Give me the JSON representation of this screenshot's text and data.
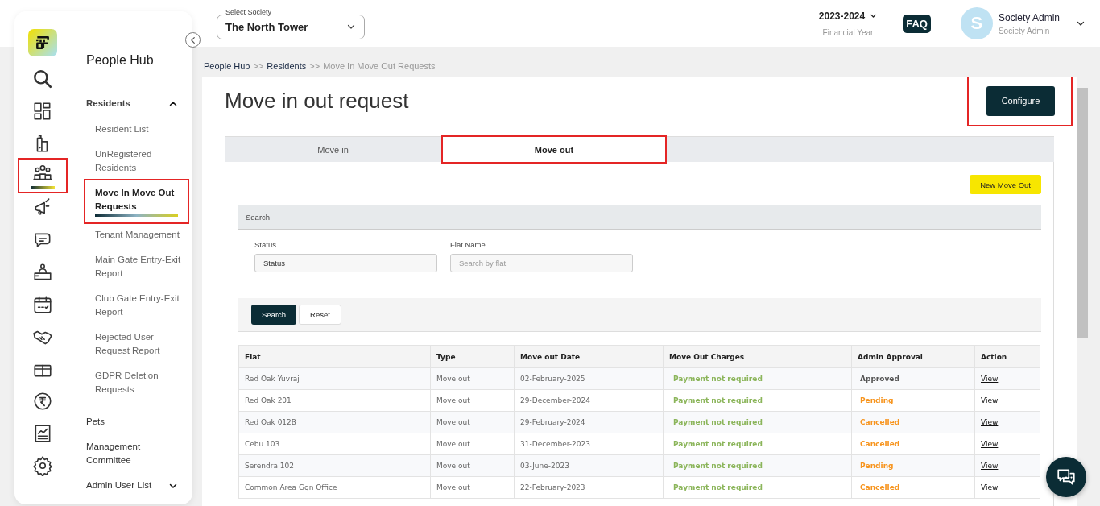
{
  "sidebar": {
    "rail": [
      {
        "selected": false,
        "highlighted": false
      },
      {
        "selected": false,
        "highlighted": false
      },
      {
        "selected": false,
        "highlighted": false
      },
      {
        "selected": true,
        "highlighted": true
      },
      {
        "selected": false,
        "highlighted": false
      },
      {
        "selected": false,
        "highlighted": false
      },
      {
        "selected": false,
        "highlighted": false
      },
      {
        "selected": false,
        "highlighted": false
      },
      {
        "selected": false,
        "highlighted": false
      },
      {
        "selected": false,
        "highlighted": false
      },
      {
        "selected": false,
        "highlighted": false
      },
      {
        "selected": false,
        "highlighted": false
      },
      {
        "selected": false,
        "highlighted": false
      }
    ],
    "title": "People Hub",
    "sections": [
      {
        "label": "Residents",
        "expanded": true,
        "children": [
          {
            "label": "Resident List",
            "selected": false,
            "highlighted": false
          },
          {
            "label": "UnRegistered Residents",
            "selected": false,
            "highlighted": false
          },
          {
            "label": "Move In Move Out Requests",
            "selected": true,
            "highlighted": true
          },
          {
            "label": "Tenant Management",
            "selected": false,
            "highlighted": false
          },
          {
            "label": "Main Gate Entry-Exit Report",
            "selected": false,
            "highlighted": false
          },
          {
            "label": "Club Gate Entry-Exit Report",
            "selected": false,
            "highlighted": false
          },
          {
            "label": "Rejected User Request Report",
            "selected": false,
            "highlighted": false
          },
          {
            "label": "GDPR Deletion Requests",
            "selected": false,
            "highlighted": false
          }
        ]
      },
      {
        "label": "Pets"
      },
      {
        "label": "Management Committee"
      },
      {
        "label": "Admin User List",
        "expanded": false
      }
    ]
  },
  "header": {
    "society_select": {
      "label": "Select Society",
      "value": "The North Tower"
    },
    "financial_year": {
      "value": "2023-2024",
      "label": "Financial Year"
    },
    "faq": "FAQ",
    "user": {
      "avatar": "S",
      "name": "Society Admin",
      "role": "Society Admin"
    }
  },
  "breadcrumb": [
    {
      "kind": "link",
      "text": "People Hub"
    },
    {
      "kind": "separator",
      "text": ">>"
    },
    {
      "kind": "link",
      "text": "Residents"
    },
    {
      "kind": "separator",
      "text": ">>"
    },
    {
      "kind": "current",
      "text": "Move In Move Out Requests"
    }
  ],
  "page": {
    "title": "Move in out request",
    "configure_button": {
      "label": "Configure",
      "highlighted": true
    },
    "tabs": [
      {
        "label": "Move in",
        "selected": false,
        "highlighted": false
      },
      {
        "label": "Move out",
        "selected": true,
        "highlighted": true
      }
    ],
    "new_button": "New Move Out",
    "search": {
      "title": "Search",
      "fields": [
        {
          "label": "Status",
          "value": "Status"
        },
        {
          "label": "Flat Name",
          "placeholder": "Search by flat"
        }
      ],
      "buttons": [
        {
          "label": "Search",
          "kind": "primary"
        },
        {
          "label": "Reset",
          "kind": "secondary"
        }
      ]
    },
    "table": {
      "columns": [
        "Flat",
        "Type",
        "Move out Date",
        "Move Out Charges",
        "Admin Approval",
        "Action"
      ],
      "rows": [
        {
          "flat": "Red Oak Yuvraj",
          "type": "Move out",
          "date": "02-February-2025",
          "charges": "Payment not required",
          "approval": "Approved",
          "color": "#555555",
          "action": "View"
        },
        {
          "flat": "Red Oak 201",
          "type": "Move out",
          "date": "29-December-2024",
          "charges": "Payment not required",
          "approval": "Pending",
          "color": "#f7941d",
          "action": "View"
        },
        {
          "flat": "Red Oak 012B",
          "type": "Move out",
          "date": "29-February-2024",
          "charges": "Payment not required",
          "approval": "Cancelled",
          "color": "#f7941d",
          "action": "View"
        },
        {
          "flat": "Cebu 103",
          "type": "Move out",
          "date": "31-December-2023",
          "charges": "Payment not required",
          "approval": "Cancelled",
          "color": "#f7941d",
          "action": "View"
        },
        {
          "flat": "Serendra 102",
          "type": "Move out",
          "date": "03-June-2023",
          "charges": "Payment not required",
          "approval": "Pending",
          "color": "#f7941d",
          "action": "View"
        },
        {
          "flat": "Common Area Ggn Office",
          "type": "Move out",
          "date": "22-February-2023",
          "charges": "Payment not required",
          "approval": "Cancelled",
          "color": "#f7941d",
          "action": "View"
        }
      ]
    }
  }
}
